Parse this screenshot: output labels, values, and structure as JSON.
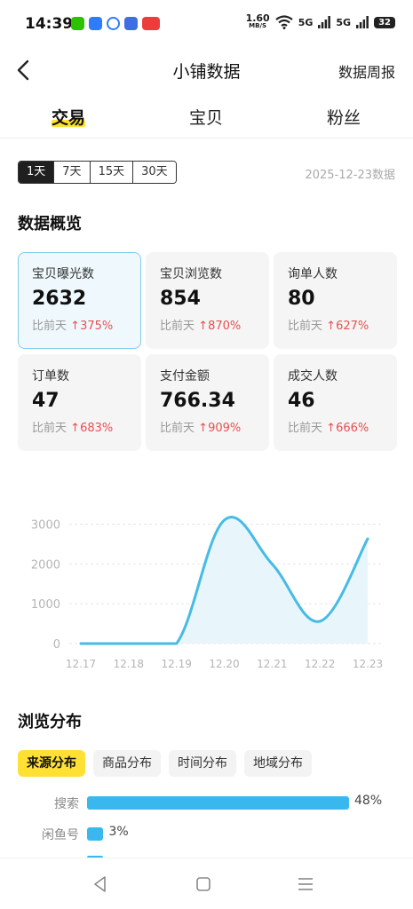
{
  "status_bar": {
    "time": "14:39",
    "net_speed_value": "1.60",
    "net_speed_unit": "MB/S",
    "signal1": "5G",
    "signal2": "5G",
    "battery": "32"
  },
  "header": {
    "title": "小铺数据",
    "report_link": "数据周报"
  },
  "main_tabs": [
    {
      "label": "交易",
      "active": true
    },
    {
      "label": "宝贝",
      "active": false
    },
    {
      "label": "粉丝",
      "active": false
    }
  ],
  "range_options": [
    "1天",
    "7天",
    "15天",
    "30天"
  ],
  "range_selected": "1天",
  "date_label": "2025-12-23数据",
  "overview": {
    "title": "数据概览",
    "compare_prefix": "比前天",
    "cards": [
      {
        "label": "宝贝曝光数",
        "value": "2632",
        "delta": "375%"
      },
      {
        "label": "宝贝浏览数",
        "value": "854",
        "delta": "870%"
      },
      {
        "label": "询单人数",
        "value": "80",
        "delta": "627%"
      },
      {
        "label": "订单数",
        "value": "47",
        "delta": "683%"
      },
      {
        "label": "支付金额",
        "value": "766.34",
        "delta": "909%"
      },
      {
        "label": "成交人数",
        "value": "46",
        "delta": "666%"
      }
    ]
  },
  "chart_data": {
    "type": "area",
    "x": [
      "12.17",
      "12.18",
      "12.19",
      "12.20",
      "12.21",
      "12.22",
      "12.23"
    ],
    "series": [
      {
        "values": [
          0,
          0,
          0,
          3100,
          2000,
          560,
          2632
        ]
      }
    ],
    "yticks": [
      0,
      1000,
      2000,
      3000
    ],
    "ylim": [
      0,
      3300
    ],
    "grid": true,
    "color": "#46bbe6",
    "fill": "#e8f6fc"
  },
  "distribution": {
    "title": "浏览分布",
    "tabs": [
      "来源分布",
      "商品分布",
      "时间分布",
      "地域分布"
    ],
    "active_tab": "来源分布",
    "bars": [
      {
        "label": "搜索",
        "pct": "48%",
        "value": 48
      },
      {
        "label": "闲鱼号",
        "pct": "3%",
        "value": 3
      }
    ]
  },
  "colors": {
    "accent_yellow": "#ffe033",
    "chart_blue": "#46bbe6",
    "bar_blue": "#3ab8ee",
    "up_red": "#e94f4f"
  }
}
